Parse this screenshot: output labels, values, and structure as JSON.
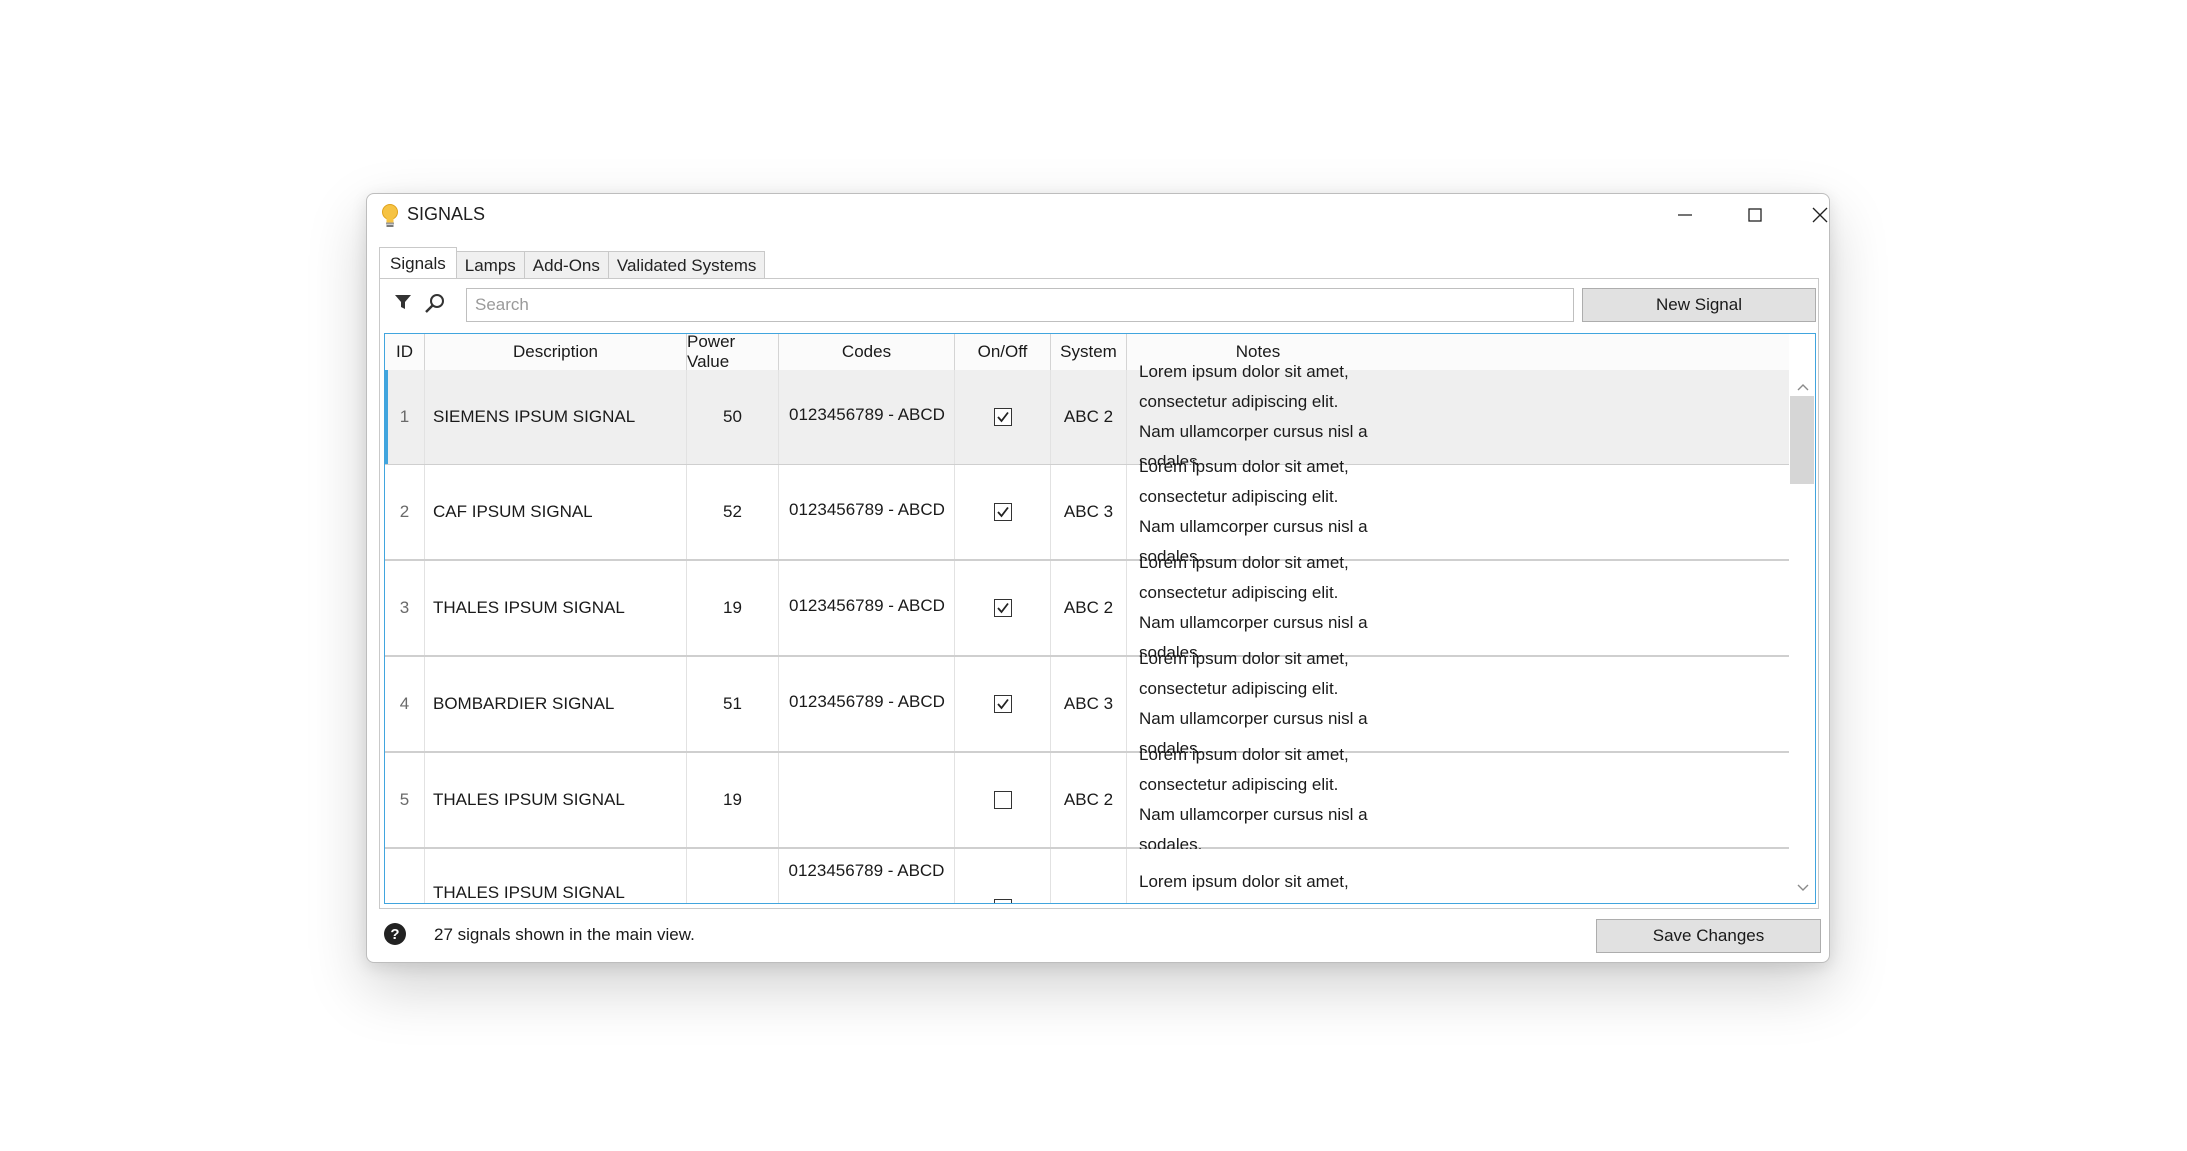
{
  "window": {
    "title": "SIGNALS"
  },
  "tabs": [
    {
      "label": "Signals",
      "active": true
    },
    {
      "label": "Lamps",
      "active": false
    },
    {
      "label": "Add-Ons",
      "active": false
    },
    {
      "label": "Validated Systems",
      "active": false
    }
  ],
  "toolbar": {
    "search_placeholder": "Search",
    "search_value": "",
    "new_signal_label": "New Signal"
  },
  "table": {
    "columns": [
      "ID",
      "Description",
      "Power Value",
      "Codes",
      "On/Off",
      "System",
      "Notes"
    ],
    "rows": [
      {
        "id": "1",
        "description": "SIEMENS IPSUM SIGNAL",
        "power": "50",
        "codes": "0123456789 - ABCD",
        "on": true,
        "system": "ABC 2",
        "notes": "Lorem ipsum dolor sit amet, consectetur adipiscing elit. Nam ullamcorper cursus nisl a sodales.",
        "selected": true
      },
      {
        "id": "2",
        "description": "CAF IPSUM SIGNAL",
        "power": "52",
        "codes": "0123456789 - ABCD",
        "on": true,
        "system": "ABC 3",
        "notes": "Lorem ipsum dolor sit amet, consectetur adipiscing elit. Nam ullamcorper cursus nisl a sodales.",
        "selected": false
      },
      {
        "id": "3",
        "description": "THALES IPSUM SIGNAL",
        "power": "19",
        "codes": "0123456789 - ABCD",
        "on": true,
        "system": "ABC 2",
        "notes": "Lorem ipsum dolor sit amet, consectetur adipiscing elit. Nam ullamcorper cursus nisl a sodales.",
        "selected": false
      },
      {
        "id": "4",
        "description": "BOMBARDIER SIGNAL",
        "power": "51",
        "codes": "0123456789 - ABCD",
        "on": true,
        "system": "ABC 3",
        "notes": "Lorem ipsum dolor sit amet, consectetur adipiscing elit. Nam ullamcorper cursus nisl a sodales.",
        "selected": false
      },
      {
        "id": "5",
        "description": "THALES IPSUM SIGNAL",
        "power": "19",
        "codes": "",
        "on": false,
        "system": "ABC 2",
        "notes": "Lorem ipsum dolor sit amet, consectetur adipiscing elit. Nam ullamcorper cursus nisl a sodales.",
        "selected": false
      }
    ],
    "partial_row": {
      "description": "THALES IPSUM SIGNAL",
      "codes": "0123456789 - ABCD",
      "notes": "Lorem ipsum dolor sit amet, consectetur"
    }
  },
  "status": {
    "message": "27 signals shown in the main view.",
    "save_label": "Save Changes"
  },
  "icons": {
    "app": "lightbulb-icon",
    "filter": "filter-icon",
    "search": "search-icon",
    "help": "help-icon"
  },
  "colors": {
    "accent": "#41a5de",
    "selected_row": "#efefef",
    "button_bg": "#e1e1e1"
  }
}
